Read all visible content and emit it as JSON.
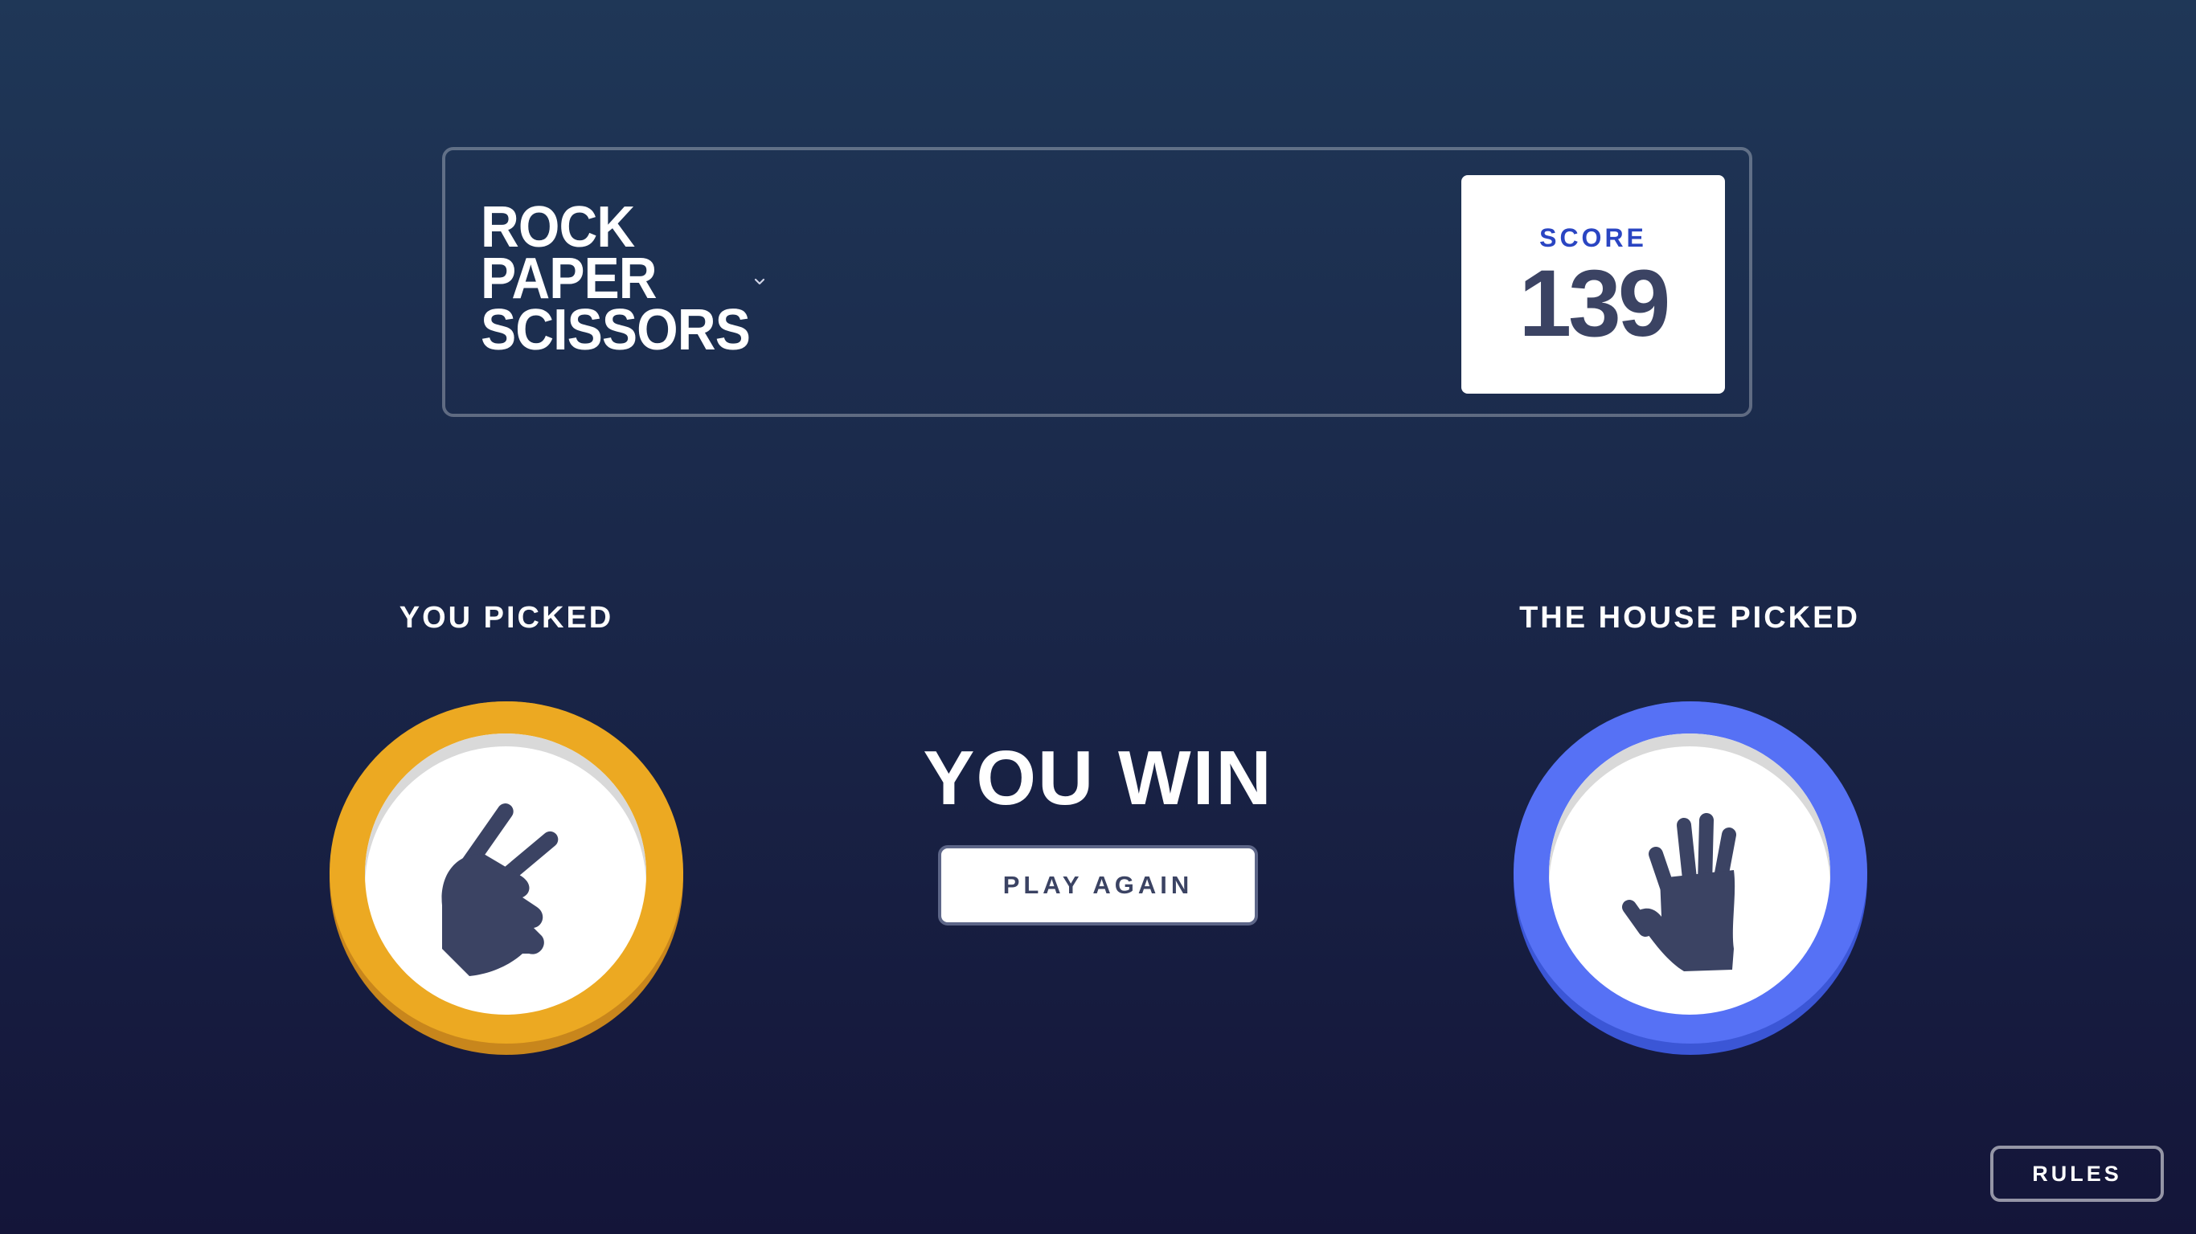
{
  "header": {
    "title_lines": [
      "ROCK",
      "PAPER",
      "SCISSORS"
    ],
    "score_label": "SCORE",
    "score_value": "139"
  },
  "game": {
    "you_picked_label": "YOU PICKED",
    "house_picked_label": "THE HOUSE PICKED",
    "player_choice": "scissors",
    "house_choice": "paper",
    "result_text": "YOU WIN",
    "play_again_label": "PLAY AGAIN"
  },
  "footer": {
    "rules_label": "RULES"
  },
  "colors": {
    "background_top": "#1f3757",
    "background_bottom": "#141539",
    "scissors_rim": "#eca922",
    "paper_rim": "#5671f5",
    "score_label": "#2a45c2",
    "dark_text": "#3b4363"
  },
  "icons": {
    "player_icon": "scissors-hand-icon",
    "house_icon": "paper-hand-icon",
    "title_chevron": "chevron-down-icon"
  }
}
